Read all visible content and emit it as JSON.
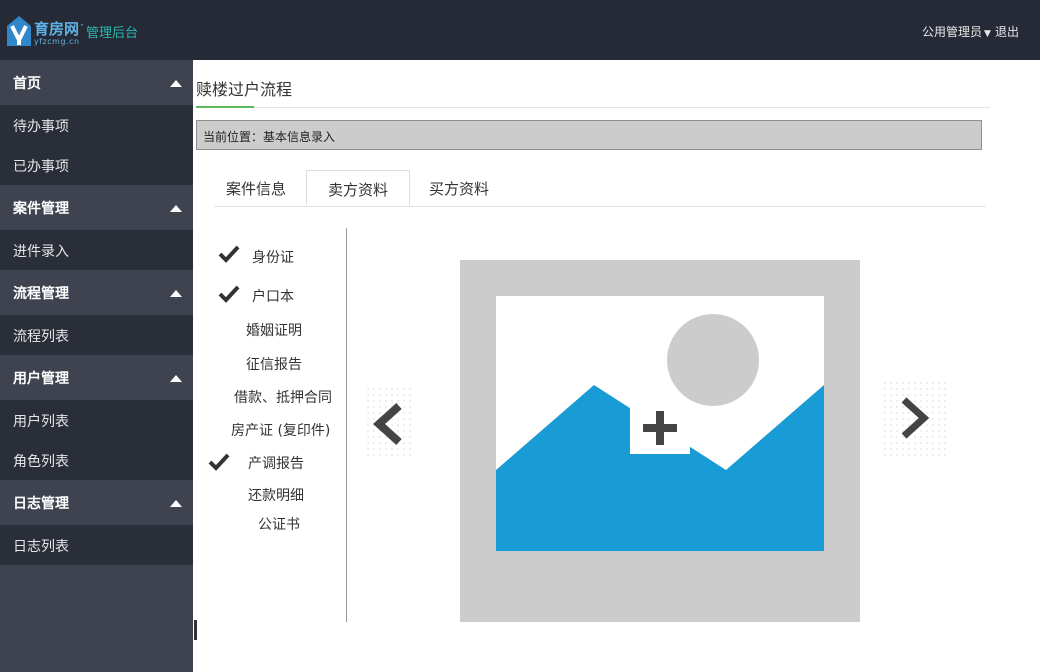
{
  "header": {
    "logo_name": "育房网",
    "logo_dot": "·",
    "logo_subtitle": "管理后台",
    "logo_domain": "yfzcmg.cn",
    "user_name": "公用管理员",
    "user_caret": "▼",
    "logout": "退出"
  },
  "sidebar": {
    "groups": [
      {
        "label": "首页",
        "items": [
          {
            "label": "待办事项"
          },
          {
            "label": "已办事项"
          }
        ]
      },
      {
        "label": "案件管理",
        "items": [
          {
            "label": "进件录入"
          }
        ]
      },
      {
        "label": "流程管理",
        "items": [
          {
            "label": "流程列表"
          }
        ]
      },
      {
        "label": "用户管理",
        "items": [
          {
            "label": "用户列表"
          },
          {
            "label": "角色列表"
          }
        ]
      },
      {
        "label": "日志管理",
        "items": [
          {
            "label": "日志列表"
          }
        ]
      }
    ]
  },
  "main": {
    "title": "赎楼过户流程",
    "breadcrumb": "当前位置：基本信息录入",
    "tabs": [
      {
        "label": "案件信息",
        "active": false
      },
      {
        "label": "卖方资料",
        "active": true
      },
      {
        "label": "买方资料",
        "active": false
      }
    ],
    "documents": [
      {
        "label": "身份证",
        "checked": true
      },
      {
        "label": "户口本",
        "checked": true
      },
      {
        "label": "婚姻证明",
        "checked": false
      },
      {
        "label": "征信报告",
        "checked": false
      },
      {
        "label": "借款、抵押合同",
        "checked": false
      },
      {
        "label": "房产证 (复印件)",
        "checked": false
      },
      {
        "label": "产调报告",
        "checked": true
      },
      {
        "label": "还款明细",
        "checked": false
      },
      {
        "label": "公证书",
        "checked": false
      }
    ],
    "upload": {
      "icon": "image-upload-icon",
      "prev_icon": "chevron-left-icon",
      "next_icon": "chevron-right-icon"
    }
  },
  "colors": {
    "topbar": "#252a36",
    "sidebar_group": "#3f4350",
    "sidebar_item": "#2a2e39",
    "accent_green": "#5cb85c",
    "image_blue": "#199bd6",
    "image_gray": "#cccccc"
  }
}
